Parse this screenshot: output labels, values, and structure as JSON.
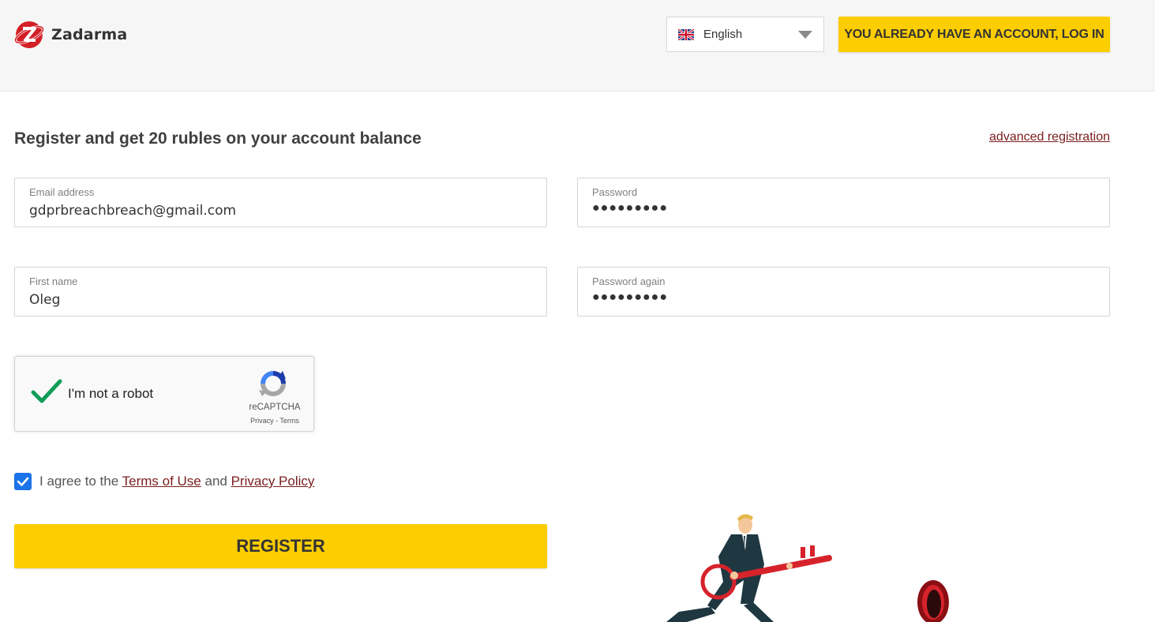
{
  "header": {
    "brand": "Zadarma",
    "language": {
      "selected": "English",
      "flag": "uk-flag-icon"
    },
    "login_button": "YOU ALREADY HAVE AN ACCOUNT, LOG IN"
  },
  "form": {
    "title": "Register and get 20 rubles on your account balance",
    "advanced_link": "advanced registration",
    "email": {
      "label": "Email address",
      "value": "gdprbreachbreach@gmail.com"
    },
    "password": {
      "label": "Password",
      "masked": "●●●●●●●●●"
    },
    "first_name": {
      "label": "First name",
      "value": "Oleg"
    },
    "password_again": {
      "label": "Password again",
      "masked": "●●●●●●●●●"
    },
    "captcha": {
      "label": "I'm not a robot",
      "brand": "reCAPTCHA",
      "links": "Privacy - Terms",
      "checked": true
    },
    "agree": {
      "prefix": "I agree to the",
      "terms": "Terms of Use",
      "and": "and",
      "privacy": "Privacy Policy",
      "checked": true
    },
    "register_button": "REGISTER"
  },
  "colors": {
    "accent": "#fccd00",
    "link": "#7a1d1d",
    "checkbox": "#1a73e8"
  }
}
